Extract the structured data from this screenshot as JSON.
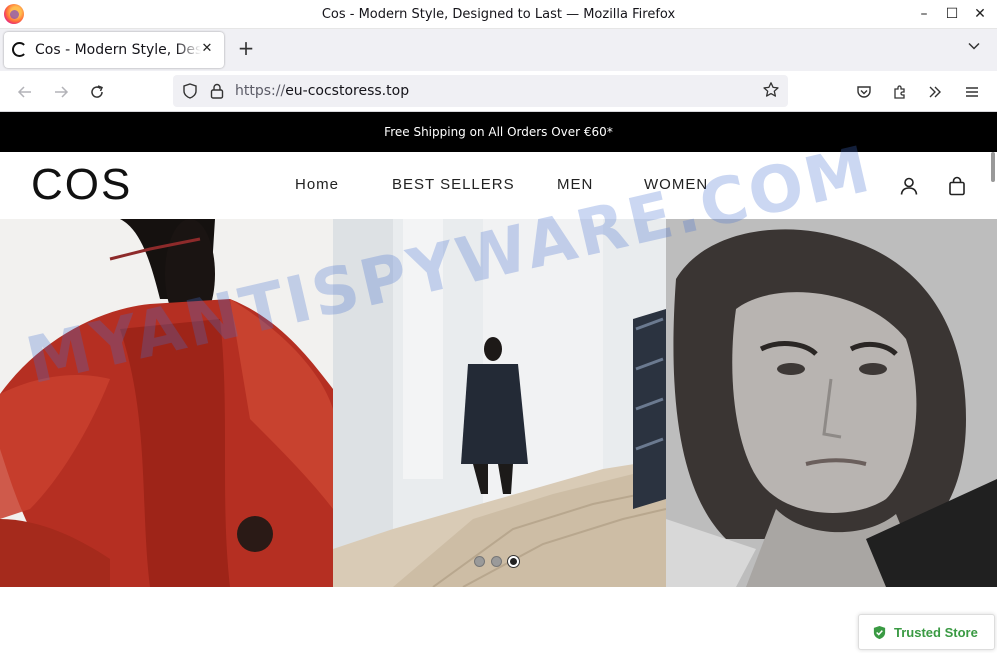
{
  "window": {
    "title": "Cos - Modern Style, Designed to Last — Mozilla Firefox",
    "controls": {
      "minimize": "–",
      "maximize": "☐",
      "close": "✕"
    }
  },
  "tabs": [
    {
      "title": "Cos - Modern Style, Designed to Last",
      "active": true
    }
  ],
  "new_tab_glyph": "+",
  "tab_list_glyph": "⌄",
  "toolbar": {
    "back": "←",
    "forward": "→",
    "reload": "↻",
    "star": "☆"
  },
  "urlbar": {
    "scheme": "https://",
    "host": "eu-cocstoress.top"
  },
  "site": {
    "announcement": "Free Shipping on All Orders Over €60*",
    "logo": "COS",
    "nav": [
      "Home",
      "BEST SELLERS",
      "MEN",
      "WOMEN"
    ],
    "hero_slides": 3,
    "hero_active_slide": 3,
    "trusted_badge": "Trusted Store"
  },
  "watermark": "MYANTISPYWARE.COM",
  "colors": {
    "announcement_bg": "#000000",
    "trusted_green": "#3a9a43",
    "watermark": "#466ed2"
  }
}
